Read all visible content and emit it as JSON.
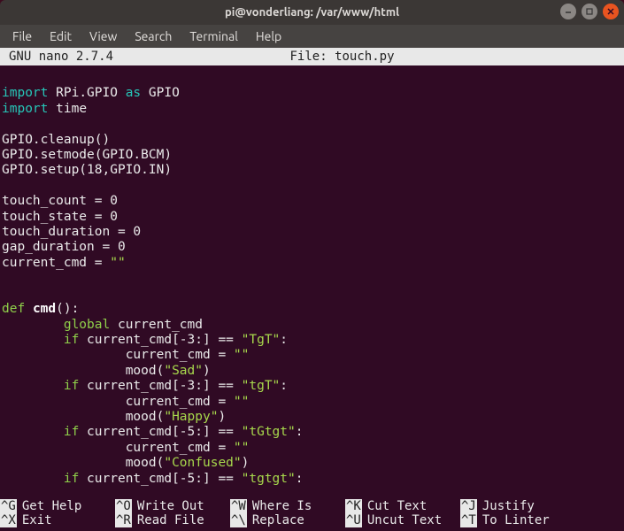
{
  "window": {
    "title": "pi@vonderliang: /var/www/html"
  },
  "menu": {
    "items": [
      "File",
      "Edit",
      "View",
      "Search",
      "Terminal",
      "Help"
    ]
  },
  "nano": {
    "version": "GNU nano 2.7.4",
    "file_label": "File: touch.py"
  },
  "code": {
    "lines": [
      {
        "type": "blank"
      },
      {
        "type": "import",
        "kw": "import",
        "mod": "RPi.GPIO",
        "as": "as",
        "alias": "GPIO"
      },
      {
        "type": "import",
        "kw": "import",
        "mod": "time"
      },
      {
        "type": "blank"
      },
      {
        "type": "plain",
        "text": "GPIO.cleanup()"
      },
      {
        "type": "plain",
        "text": "GPIO.setmode(GPIO.BCM)"
      },
      {
        "type": "plain",
        "text": "GPIO.setup(18,GPIO.IN)"
      },
      {
        "type": "blank"
      },
      {
        "type": "assign",
        "text": "touch_count = 0"
      },
      {
        "type": "assign",
        "text": "touch_state = 0"
      },
      {
        "type": "assign",
        "text": "touch_duration = 0"
      },
      {
        "type": "assign",
        "text": "gap_duration = 0"
      },
      {
        "type": "assignstr",
        "pre": "current_cmd = ",
        "str": "\"\""
      },
      {
        "type": "blank"
      },
      {
        "type": "blank"
      },
      {
        "type": "def",
        "kw": "def",
        "name": "cmd",
        "sig": "():"
      },
      {
        "type": "global",
        "indent": "        ",
        "kw": "global",
        "rest": " current_cmd"
      },
      {
        "type": "if",
        "indent": "        ",
        "kw": "if",
        "mid": " current_cmd[-3:] == ",
        "str": "\"TgT\"",
        "post": ":"
      },
      {
        "type": "assignstr",
        "indent": "                ",
        "pre": "current_cmd = ",
        "str": "\"\""
      },
      {
        "type": "call",
        "indent": "                ",
        "pre": "mood(",
        "str": "\"Sad\"",
        "post": ")"
      },
      {
        "type": "if",
        "indent": "        ",
        "kw": "if",
        "mid": " current_cmd[-3:] == ",
        "str": "\"tgT\"",
        "post": ":"
      },
      {
        "type": "assignstr",
        "indent": "                ",
        "pre": "current_cmd = ",
        "str": "\"\""
      },
      {
        "type": "call",
        "indent": "                ",
        "pre": "mood(",
        "str": "\"Happy\"",
        "post": ")"
      },
      {
        "type": "if",
        "indent": "        ",
        "kw": "if",
        "mid": " current_cmd[-5:] == ",
        "str": "\"tGtgt\"",
        "post": ":"
      },
      {
        "type": "assignstr",
        "indent": "                ",
        "pre": "current_cmd = ",
        "str": "\"\""
      },
      {
        "type": "call",
        "indent": "                ",
        "pre": "mood(",
        "str": "\"Confused\"",
        "post": ")"
      },
      {
        "type": "if",
        "indent": "        ",
        "kw": "if",
        "mid": " current_cmd[-5:] == ",
        "str": "\"tgtgt\"",
        "post": ":"
      }
    ]
  },
  "footer": {
    "rows": [
      [
        {
          "key": "^G",
          "label": "Get Help"
        },
        {
          "key": "^O",
          "label": "Write Out"
        },
        {
          "key": "^W",
          "label": "Where Is"
        },
        {
          "key": "^K",
          "label": "Cut Text"
        },
        {
          "key": "^J",
          "label": "Justify"
        }
      ],
      [
        {
          "key": "^X",
          "label": "Exit"
        },
        {
          "key": "^R",
          "label": "Read File"
        },
        {
          "key": "^\\",
          "label": "Replace"
        },
        {
          "key": "^U",
          "label": "Uncut Text"
        },
        {
          "key": "^T",
          "label": "To Linter"
        }
      ]
    ]
  }
}
